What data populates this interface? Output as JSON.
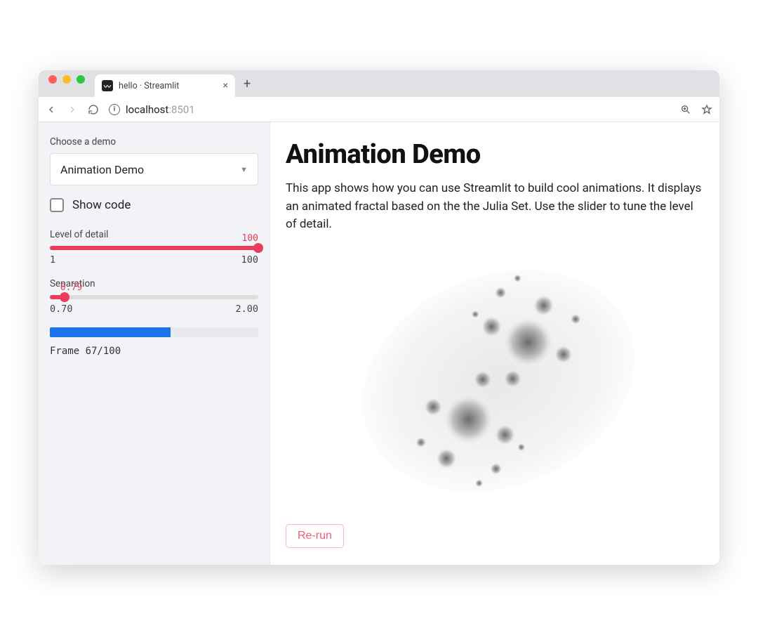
{
  "browser": {
    "tab_title": "hello · Streamlit",
    "url_host": "localhost",
    "url_port": ":8501"
  },
  "sidebar": {
    "choose_label": "Choose a demo",
    "select_value": "Animation Demo",
    "show_code_label": "Show code",
    "slider_detail": {
      "label": "Level of detail",
      "value": "100",
      "min": "1",
      "max": "100"
    },
    "slider_sep": {
      "label": "Separation",
      "value": "0.79",
      "min": "0.70",
      "max": "2.00"
    },
    "frame_text": "Frame 67/100",
    "progress_percent": 58
  },
  "main": {
    "title": "Animation Demo",
    "desc": "This app shows how you can use Streamlit to build cool animations. It displays an animated fractal based on the the Julia Set. Use the slider to tune the level of detail.",
    "rerun_label": "Re-run"
  }
}
